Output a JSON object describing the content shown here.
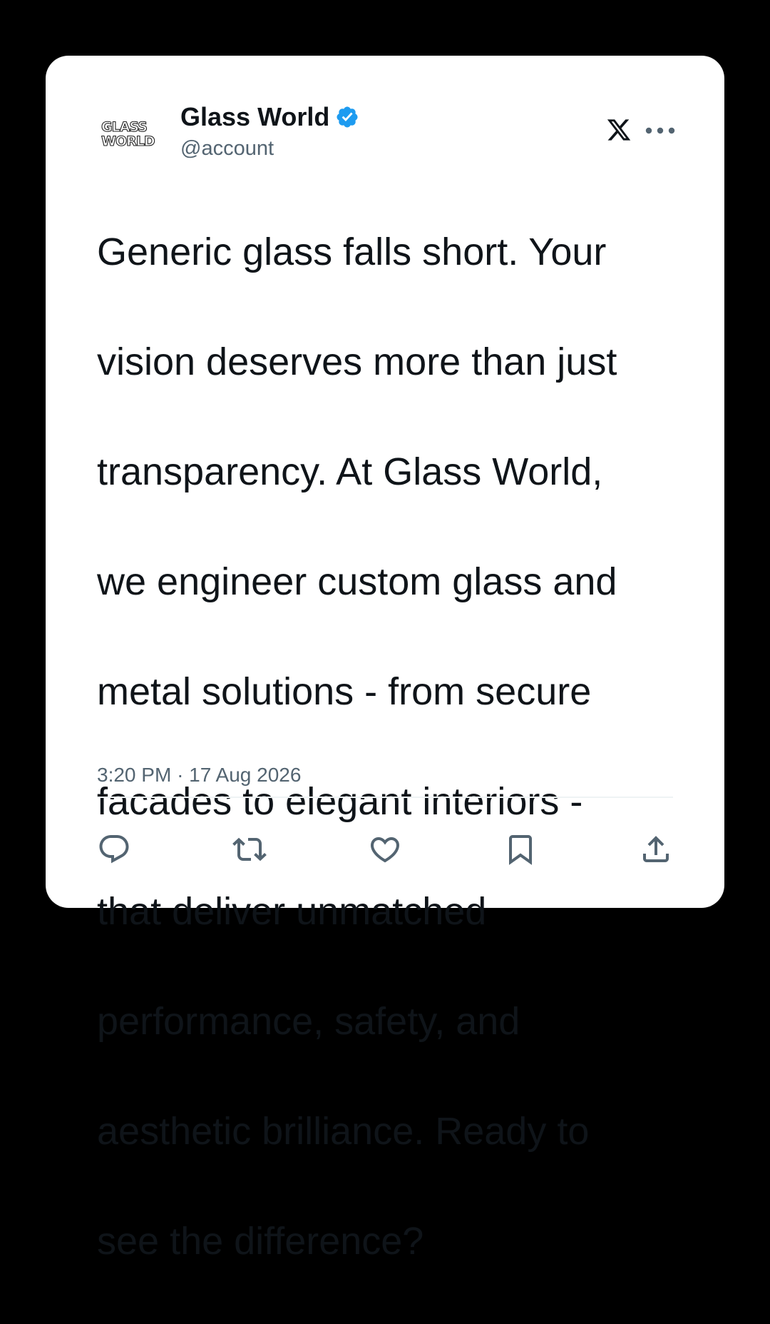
{
  "account": {
    "avatar_text": "GLASS WORLD",
    "display_name": "Glass World",
    "handle": "@account",
    "verified": true,
    "verified_color": "#1d9bf0"
  },
  "tweet": {
    "text_lines": [
      "Generic glass falls short. Your",
      "vision deserves more than just",
      "transparency. At Glass World,",
      "we engineer custom glass and",
      "metal solutions - from secure",
      "facades to elegant interiors -",
      "that deliver unmatched",
      "performance, safety, and",
      "aesthetic brilliance. Ready to",
      "see the difference?"
    ],
    "time": "3:20 PM",
    "separator": "·",
    "date": "17 Aug 2026"
  },
  "icons": {
    "platform": "x-logo-icon",
    "menu": "more-options-icon",
    "actions": [
      "reply-icon",
      "retweet-icon",
      "like-icon",
      "bookmark-icon",
      "share-icon"
    ]
  },
  "colors": {
    "background": "#000000",
    "card": "#ffffff",
    "text": "#0f1419",
    "secondary_text": "#536471",
    "icon": "#536471"
  }
}
